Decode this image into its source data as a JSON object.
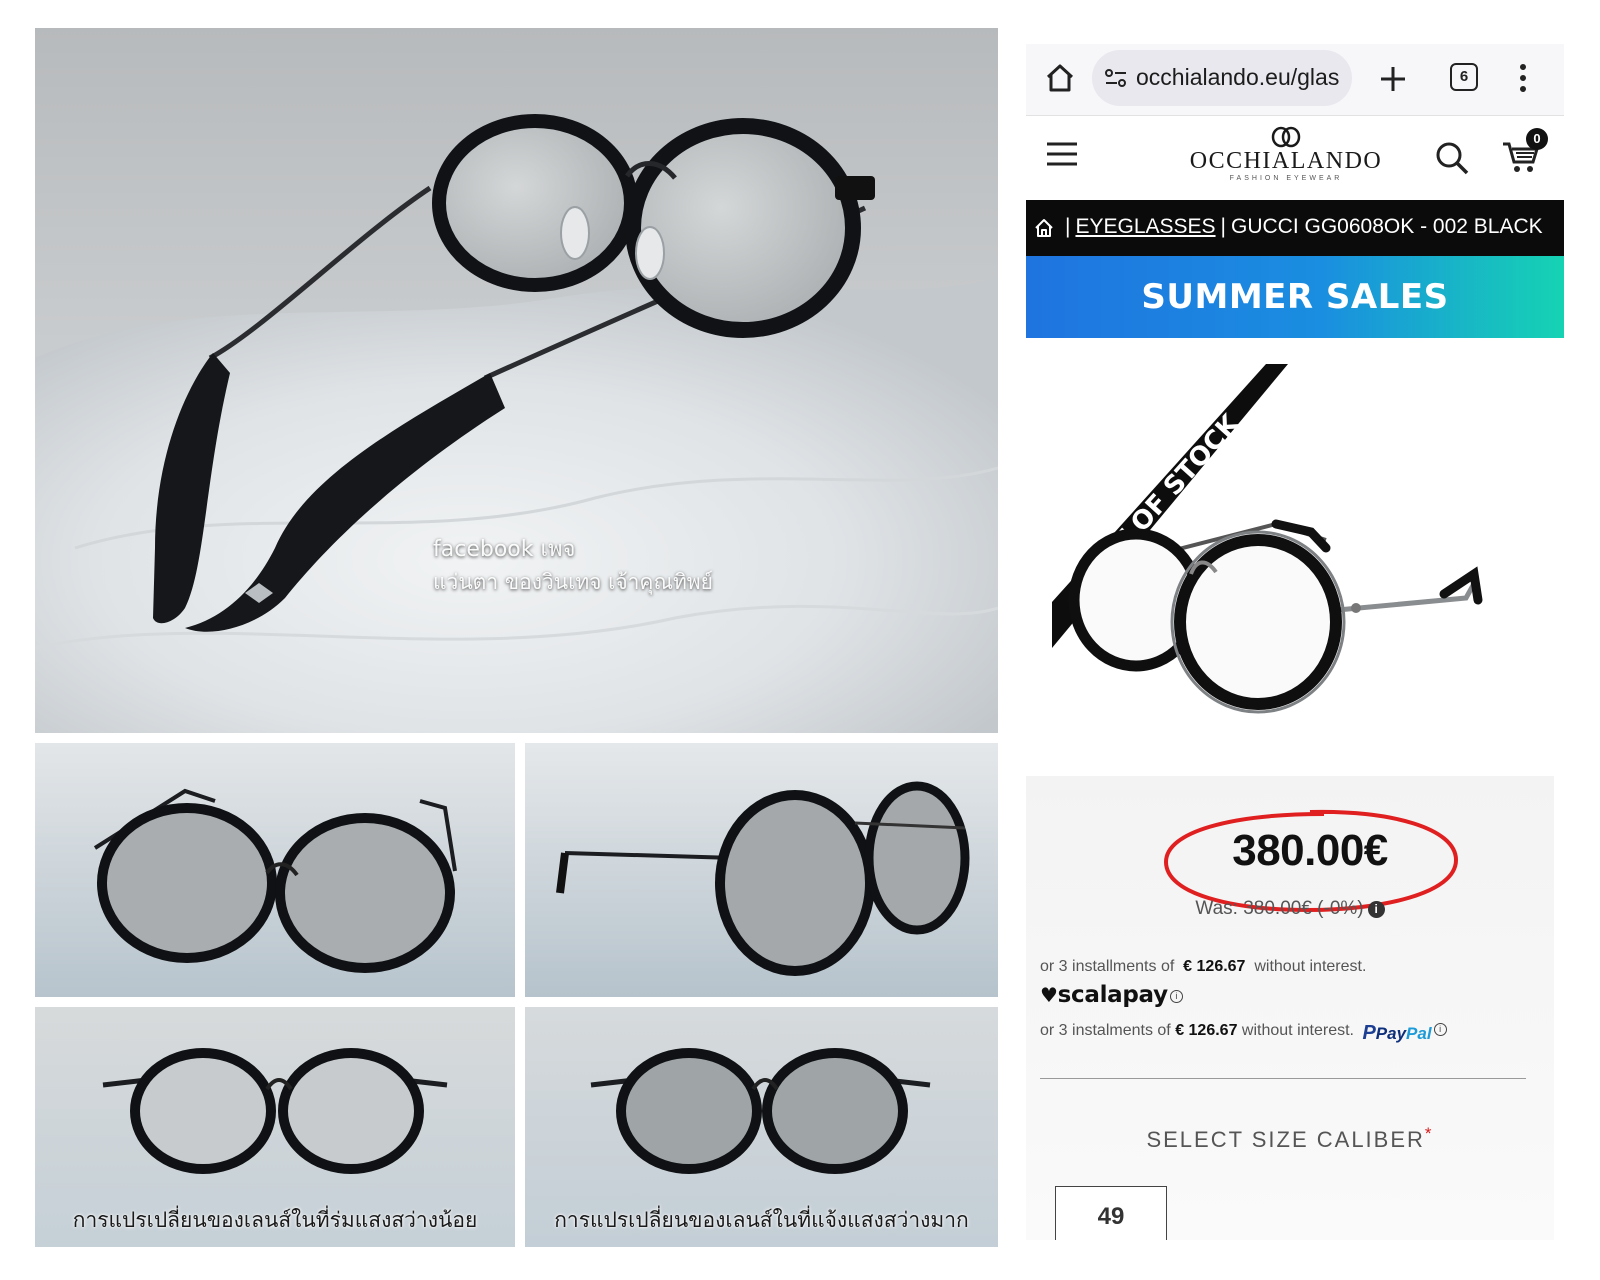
{
  "photos": {
    "main_watermark_line1": "facebook เพจ",
    "main_watermark_line2": "แว่นตา ของวินเทจ เจ้าคุณทิพย์",
    "caption_indoor": "การแปรเปลี่ยนของเลนส์ในที่ร่มแสงสว่างน้อย",
    "caption_outdoor": "การแปรเปลี่ยนของเลนส์ในที่แจ้งแสงสว่างมาก"
  },
  "browser": {
    "url": "occhialando.eu/glas",
    "tab_count": "6"
  },
  "site": {
    "logo_text": "OCCHIALANDO",
    "logo_subtitle": "FASHION EYEWEAR",
    "cart_count": "0"
  },
  "breadcrumb": {
    "separator": "|",
    "category": "EYEGLASSES",
    "product": "GUCCI GG0608OK - 002 BLACK"
  },
  "promo": {
    "text": "SUMMER SALES"
  },
  "product": {
    "stock_ribbon": "OUT OF STOCK",
    "price": "380.00€",
    "was_price": "Was: 380.00€ (-0%)",
    "installments_scalapay": {
      "prefix": "or 3 installments of",
      "amount": "€ 126.67",
      "suffix": "without interest."
    },
    "scalapay_brand": "scalapay",
    "installments_paypal": {
      "prefix": "or 3 instalments of",
      "amount": "€ 126.67",
      "suffix": "without interest."
    },
    "paypal_brand_pay": "Pay",
    "paypal_brand_pal": "Pal",
    "size_label": "SELECT SIZE CALIBER",
    "size_required_mark": "*",
    "size_option": "49"
  },
  "colors": {
    "promo_gradient_start": "#1f74e0",
    "promo_gradient_end": "#16d3b3",
    "price_circle": "#e02020",
    "breadcrumb_bg": "#0b0b0b"
  },
  "icons": [
    "home-icon",
    "site-settings-icon",
    "plus-icon",
    "tab-switcher-icon",
    "more-vert-icon",
    "hamburger-menu-icon",
    "search-icon",
    "cart-icon",
    "info-icon",
    "heart-icon"
  ]
}
